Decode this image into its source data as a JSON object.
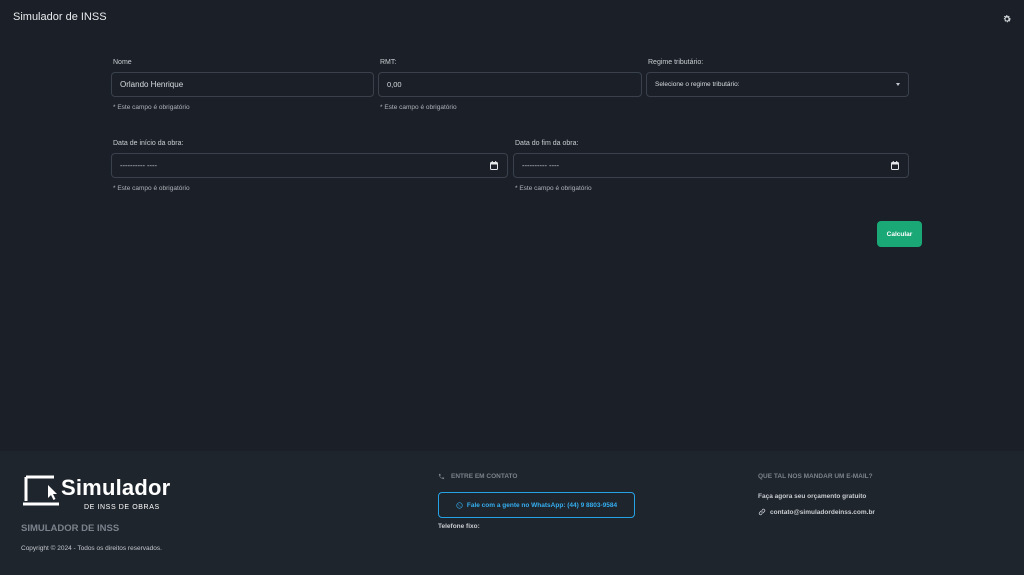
{
  "header": {
    "title": "Simulador de INSS",
    "settings_icon": "gear-icon"
  },
  "form": {
    "nome": {
      "label": "Nome",
      "value": "Orlando Henrique",
      "hint": "* Este campo é obrigatório"
    },
    "rmt": {
      "label": "RMT:",
      "value": "0,00",
      "hint": "* Este campo é obrigatório"
    },
    "regime": {
      "label": "Regime tributário:",
      "selected": "Selecione o regime tributário:"
    },
    "data_inicio": {
      "label": "Data de início da obra:",
      "value": "---------- ----",
      "hint": "* Este campo é obrigatório"
    },
    "data_fim": {
      "label": "Data do fim da obra:",
      "value": "---------- ----",
      "hint": "* Este campo é obrigatório"
    },
    "submit_label": "Calcular"
  },
  "colors": {
    "background": "#1b2028",
    "footer": "#1f252d",
    "accent": "#1aa877",
    "link": "#34aef0"
  },
  "footer": {
    "logo": {
      "word": "Simulador",
      "sub": "DE INSS DE OBRAS"
    },
    "brand_name": "SIMULADOR DE INSS",
    "copyright": "Copyright © 2024 - Todos os direitos reservados.",
    "contact": {
      "heading": "ENTRE EM CONTATO",
      "whatsapp_label": "Fale com a gente no WhatsApp: (44) 9 8803-9584",
      "phone_label": "Telefone fixo:"
    },
    "email": {
      "heading": "QUE TAL NOS MANDAR UM E-MAIL?",
      "subtitle": "Faça agora seu orçamento gratuito",
      "address": "contato@simuladordeinss.com.br"
    }
  }
}
